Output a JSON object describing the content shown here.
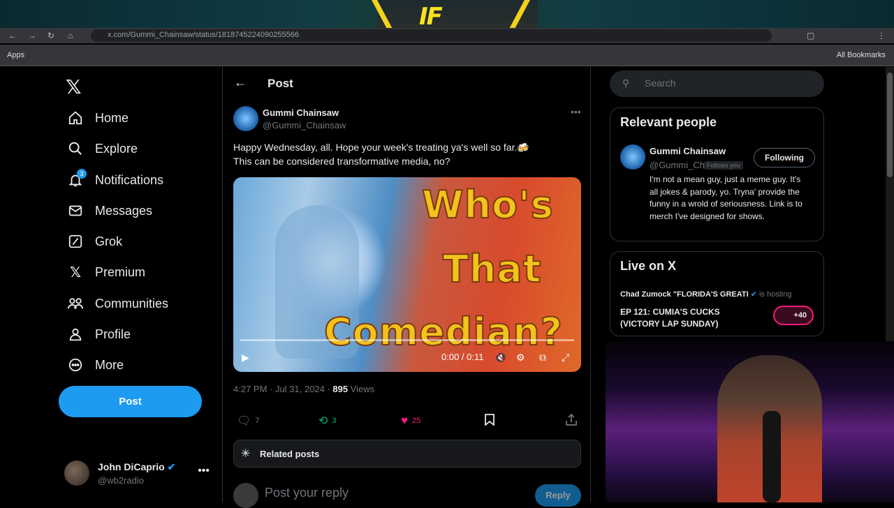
{
  "browser": {
    "url": "x.com/Gummi_Chainsaw/status/1818745224090255566",
    "bookmark_apps": "Apps",
    "bookmark_all": "All Bookmarks"
  },
  "banner": {
    "logo_text": "IF"
  },
  "nav": {
    "items": [
      {
        "label": "Home",
        "icon": "home-icon"
      },
      {
        "label": "Explore",
        "icon": "search-icon"
      },
      {
        "label": "Notifications",
        "icon": "bell-icon",
        "badge": "3"
      },
      {
        "label": "Messages",
        "icon": "mail-icon"
      },
      {
        "label": "Grok",
        "icon": "grok-icon"
      },
      {
        "label": "Premium",
        "icon": "x-icon"
      },
      {
        "label": "Communities",
        "icon": "people-icon"
      },
      {
        "label": "Profile",
        "icon": "person-icon"
      },
      {
        "label": "More",
        "icon": "more-icon"
      }
    ],
    "post_button": "Post",
    "account": {
      "name": "John DiCaprio",
      "handle": "@wb2radio"
    }
  },
  "post": {
    "header_title": "Post",
    "author_name": "Gummi Chainsaw",
    "author_handle": "@Gummi_Chainsaw",
    "text_line1": "Happy Wednesday, all. Hope your week's treating ya's well so far.🍻",
    "text_line2": "This can be considered transformative media, no?",
    "video": {
      "title_words": [
        "Who's",
        "That",
        "Comedian?"
      ],
      "time": "0:00 / 0:11",
      "progress": 0
    },
    "time": "4:27 PM · Jul 31, 2024 · ",
    "views_count": "895",
    "views_label": " Views",
    "replies": "7",
    "reposts": "3",
    "likes": "25",
    "related_label": "Related posts",
    "reply_placeholder": "Post your reply",
    "reply_button": "Reply"
  },
  "sidebar": {
    "search_placeholder": "Search",
    "relevant_title": "Relevant people",
    "person": {
      "name": "Gummi Chainsaw",
      "handle": "@Gummi_Ch",
      "follows_you": "Follows you",
      "follow_button": "Following",
      "bio": "I'm not a mean guy, just a meme guy. It's all jokes & parody, yo. Tryna' provide the funny in a wrold of seriousness. Link is to merch I've designed for shows."
    },
    "live_title": "Live on X",
    "live": {
      "host": "Chad Zumock \"FLORIDA'S GREATI",
      "hosting": "is hosting",
      "episode": "EP 121: CUMIA'S CUCKS (VICTORY LAP SUNDAY)",
      "listeners": "+40"
    }
  },
  "colors": {
    "accent": "#1d9bf0",
    "like": "#f91880",
    "repost": "#00ba7c",
    "muted": "#71767b"
  }
}
